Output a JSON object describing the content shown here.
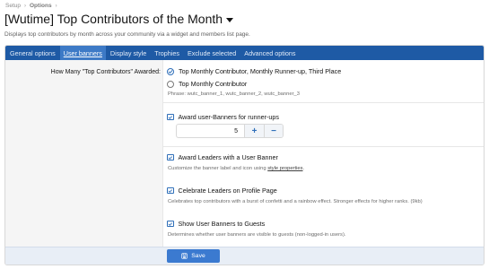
{
  "breadcrumb": {
    "items": [
      "Setup",
      "Options"
    ]
  },
  "page": {
    "title": "[Wutime] Top Contributors of the Month",
    "description": "Displays top contributors by month across your community via a widget and members list page."
  },
  "tabs": [
    {
      "label": "General options",
      "active": false
    },
    {
      "label": "User banners",
      "active": true
    },
    {
      "label": "Display style",
      "active": false
    },
    {
      "label": "Trophies",
      "active": false
    },
    {
      "label": "Exclude selected",
      "active": false
    },
    {
      "label": "Advanced options",
      "active": false
    }
  ],
  "form": {
    "how_many_label": "How Many \"Top Contributors\" Awarded:",
    "radio_options": [
      {
        "label": "Top Monthly Contributor, Monthly Runner-up, Third Place",
        "checked": true
      },
      {
        "label": "Top Monthly Contributor",
        "checked": false
      }
    ],
    "phrase_hint": "Phrase: wutc_banner_1, wutc_banner_2, wutc_banner_3",
    "runner_ups": {
      "label": "Award user-Banners for runner-ups",
      "checked": true
    },
    "stepper": {
      "value": "5",
      "plus": "+",
      "minus": "−"
    },
    "leaders_banner": {
      "label": "Award Leaders with a User Banner",
      "checked": true
    },
    "leaders_hint_prefix": "Customize the banner label and icon using",
    "leaders_hint_link": "style properties",
    "leaders_hint_suffix": ".",
    "celebrate": {
      "label": "Celebrate Leaders on Profile Page",
      "checked": true
    },
    "celebrate_hint": "Celebrates top contributors with a burst of confetti and a rainbow effect. Stronger effects for higher ranks. (9kb)",
    "guests": {
      "label": "Show User Banners to Guests",
      "checked": true
    },
    "guests_hint": "Determines whether user banners are visible to guests (non-logged-in users)."
  },
  "footer": {
    "save_label": "Save"
  },
  "colors": {
    "accent": "#1e5aa5",
    "active_tab": "#3d7ac6",
    "button": "#3b7ad0"
  }
}
